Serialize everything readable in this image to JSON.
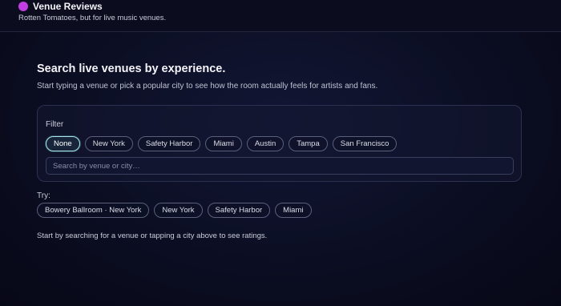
{
  "app": {
    "title": "Venue Reviews",
    "tagline": "Rotten Tomatoes, but for live music venues.",
    "logo_color": "#c23ee2"
  },
  "hero": {
    "headline": "Search live venues by experience.",
    "subtext": "Start typing a venue or pick a popular city to see how the room actually feels for artists and fans."
  },
  "filter": {
    "label": "Filter",
    "selected": "None",
    "chips": [
      "None",
      "New York",
      "Safety Harbor",
      "Miami",
      "Austin",
      "Tampa",
      "San Francisco"
    ]
  },
  "search": {
    "placeholder": "Search by venue or city…",
    "value": ""
  },
  "try": {
    "label": "Try:",
    "suggestions": [
      "Bowery Ballroom · New York",
      "New York",
      "Safety Harbor",
      "Miami"
    ]
  },
  "hint": "Start by searching for a venue or tapping a city above to see ratings.",
  "colors": {
    "accent_chip_border": "#a8e6e8",
    "background": "#0b0e22"
  }
}
